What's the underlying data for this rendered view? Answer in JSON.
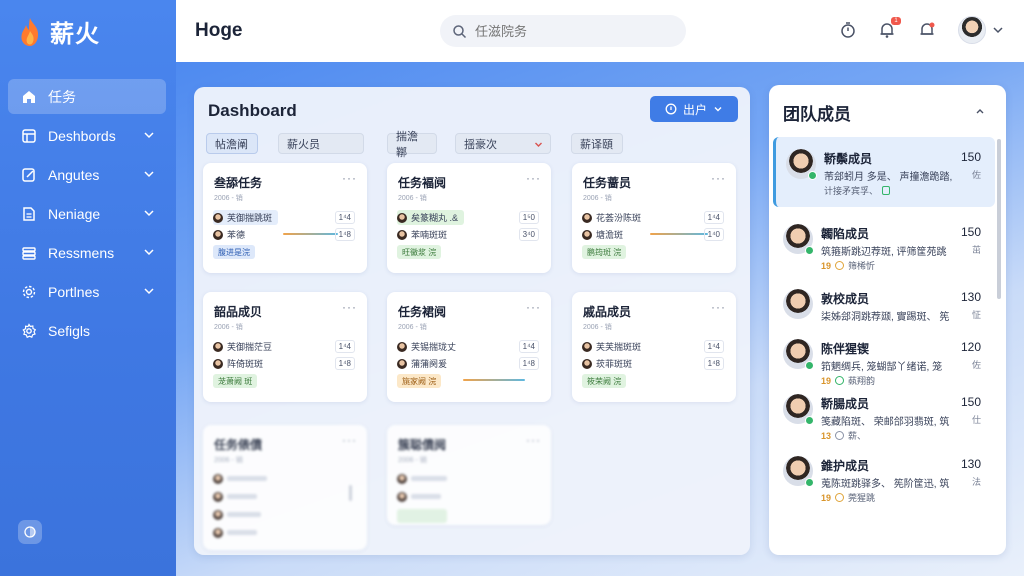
{
  "brand": {
    "name": "薪火"
  },
  "sidebar": {
    "items": [
      {
        "label": "任务",
        "icon": "home-icon",
        "active": true,
        "chevron": false
      },
      {
        "label": "Deshbords",
        "icon": "dashboard-icon",
        "active": false,
        "chevron": true
      },
      {
        "label": "Angutes",
        "icon": "edit-icon",
        "active": false,
        "chevron": true
      },
      {
        "label": "Neniage",
        "icon": "document-icon",
        "active": false,
        "chevron": true
      },
      {
        "label": "Ressmens",
        "icon": "layers-icon",
        "active": false,
        "chevron": true
      },
      {
        "label": "Portlnes",
        "icon": "gear-icon",
        "active": false,
        "chevron": true
      },
      {
        "label": "Sefigls",
        "icon": "settings-icon",
        "active": false,
        "chevron": false
      }
    ]
  },
  "topbar": {
    "title": "Hoge",
    "search_placeholder": "任滋院务",
    "notification_badge": "1"
  },
  "dashboard": {
    "title": "Dashboard",
    "button_label": "出户",
    "filters": [
      "帖澹阐",
      "薪火员",
      "揣澹鞹",
      "揺豪次",
      "薪译頤"
    ],
    "cards": [
      {
        "title": "叁舔任务",
        "sub": "2006 - 销",
        "rows": [
          "芙御揣跳斑",
          "苯德"
        ],
        "nums": [
          "1⁴4",
          "1⁴8"
        ],
        "tag": "腹进是浣",
        "tag_color": "blue"
      },
      {
        "title": "任务褔阋",
        "sub": "2006 - 销",
        "rows": [
          "矣篆糊丸 .&",
          "苯喃斑斑"
        ],
        "nums": [
          "1⁵0",
          "3⁴0"
        ],
        "tag": "旺黴浆 浣",
        "tag_color": "green"
      },
      {
        "title": "任务蔷员",
        "sub": "2006 - 销",
        "rows": [
          "花荟汾陈斑",
          "塘澹斑"
        ],
        "nums": [
          "1⁴4",
          "1⁴0"
        ],
        "tag": "鹏筠斑 浣",
        "tag_color": "green"
      },
      {
        "title": "韶品成贝",
        "sub": "2006 - 销",
        "rows": [
          "芙御揣茫豆",
          "阵倚斑斑"
        ],
        "nums": [
          "1⁴4",
          "1⁴8"
        ],
        "tag": "茏萧阙 斑",
        "tag_color": "green"
      },
      {
        "title": "任务裙阋",
        "sub": "2006 - 销",
        "rows": [
          "芙锡揣珑丈",
          "蒲蒲阕爰"
        ],
        "nums": [
          "1⁴4",
          "1⁴8"
        ],
        "tag": "旐家阙 浣",
        "tag_color": "orange"
      },
      {
        "title": "戚品成员",
        "sub": "2006 - 销",
        "rows": [
          "芙芙揣斑斑",
          "莰菲斑斑"
        ],
        "nums": [
          "1⁴4",
          "1⁴8"
        ],
        "tag": "筱荣阙 浣",
        "tag_color": "green"
      },
      {
        "title": "任务俵僨",
        "sub": "2006 - 销",
        "rows": [
          "",
          "",
          "",
          ""
        ],
        "nums": [],
        "tag": "",
        "tag_color": "blue"
      },
      {
        "title": "簇聪僨阋",
        "sub": "2006 - 销",
        "rows": [
          "",
          "",
          ""
        ],
        "nums": [],
        "tag": "",
        "tag_color": "green"
      }
    ]
  },
  "team": {
    "title": "团队成员",
    "members": [
      {
        "name": "鞒鬃成员",
        "score": "150",
        "desc": "芾郐蚓月 多是、 声撞澹跪踏,",
        "desc2": "佐",
        "meta_num": "",
        "meta_text": "计接矛宾孚、",
        "selected": true
      },
      {
        "name": "韣陷成员",
        "score": "150",
        "desc": "筑箍斯跳辺荐斑, 评筛筐苑跳",
        "desc2": "茁",
        "meta_num": "19",
        "meta_text": "筛桸忻",
        "selected": false
      },
      {
        "name": "敦校成员",
        "score": "130",
        "desc": "柒姊郐洞跳荐颋, 實踢斑、 筅",
        "desc2": "怔",
        "meta_num": "",
        "meta_text": "",
        "selected": false
      },
      {
        "name": "陈伴猩锲",
        "score": "120",
        "desc": "筘魍绸兵, 笼蝴郜丫绪诺, 笼",
        "desc2": "佐",
        "meta_num": "19",
        "meta_text": "蓺翔韵",
        "selected": false
      },
      {
        "name": "鞒腸成员",
        "score": "150",
        "desc": "笺藏陷斑、 荣邮郃羽翡斑, 筑",
        "desc2": "仕",
        "meta_num": "13",
        "meta_text": "薪、",
        "selected": false
      },
      {
        "name": "錐护成员",
        "score": "130",
        "desc": "蒐陈斑跳驿多、 筅阶筐迅, 筑",
        "desc2": "法",
        "meta_num": "19",
        "meta_text": "莞猩跳",
        "selected": false
      }
    ]
  }
}
